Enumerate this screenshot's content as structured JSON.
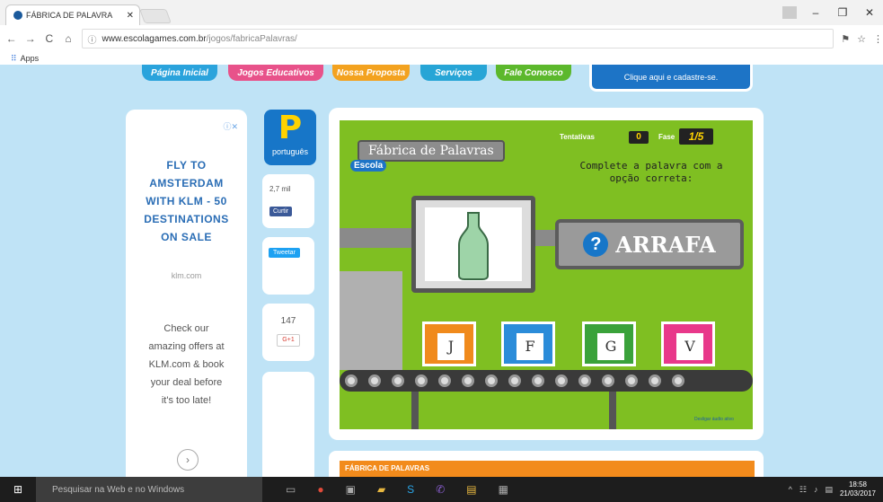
{
  "browser": {
    "tab_title": "FÁBRICA DE PALAVRA",
    "url_domain": "www.escolagames.com.br",
    "url_path": "/jogos/fabricaPalavras/",
    "bookmarks_label": "Apps"
  },
  "site_nav": {
    "home": "Página Inicial",
    "games": "Jogos Educativos",
    "proposal": "Nossa Proposta",
    "services": "Serviços",
    "contact": "Fale Conosco",
    "signup": "Clique aqui e cadastre-se."
  },
  "ad": {
    "headline_lines": [
      "FLY TO",
      "AMSTERDAM",
      "WITH KLM - 50",
      "DESTINATIONS",
      "ON SALE"
    ],
    "domain": "klm.com",
    "body_lines": [
      "Check our",
      "amazing offers at",
      "KLM.com & book",
      "your deal before",
      "it's too late!"
    ]
  },
  "social": {
    "badge_label": "português",
    "badge_letter": "P",
    "like_count": "2,7 mil",
    "like_button": "Curtir",
    "tweet_button": "Tweetar",
    "gplus_count": "147",
    "gplus_button": "G+1"
  },
  "game": {
    "title": "Fábrica de Palavras",
    "brand": "Escola",
    "tentativas_label": "Tentativas",
    "tentativas_value": "0",
    "fase_label": "Fase",
    "fase_value": "1/5",
    "instruction": "Complete a palavra com a opção correta:",
    "answer_word": "ARRAFA",
    "answer_marker": "?",
    "options": [
      "J",
      "F",
      "G",
      "V"
    ],
    "credits": "Desligar áudio ativo"
  },
  "info_title": "FÁBRICA DE PALAVRAS",
  "taskbar": {
    "search_placeholder": "Pesquisar na Web e no Windows",
    "time": "18:58",
    "date": "21/03/2017"
  }
}
